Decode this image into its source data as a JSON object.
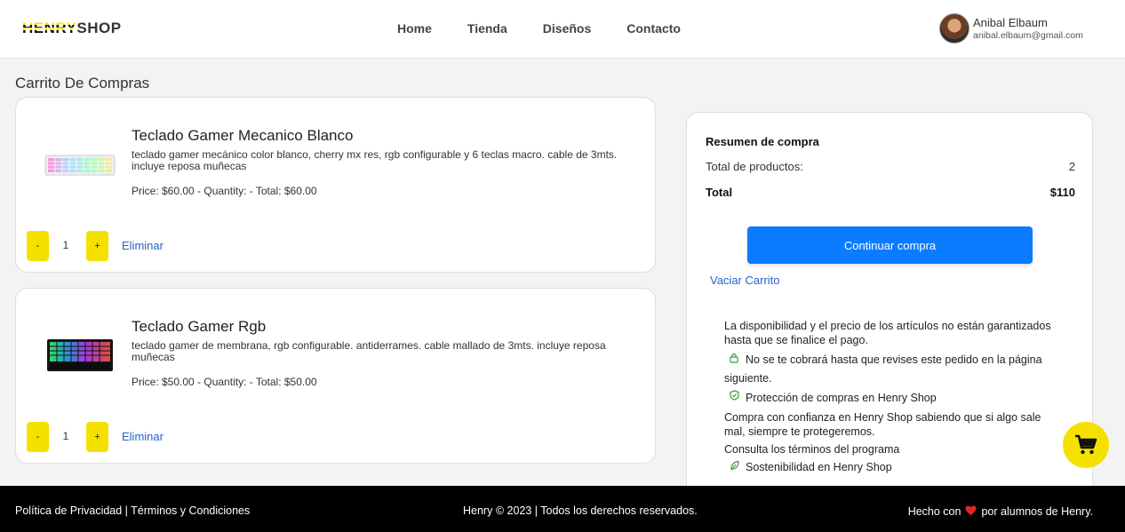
{
  "header": {
    "logo_henry": "HENRY",
    "logo_shop": "SHOP",
    "nav": [
      "Home",
      "Tienda",
      "Diseños",
      "Contacto"
    ],
    "user": {
      "name": "Anibal Elbaum",
      "email": "anibal.elbaum@gmail.com"
    }
  },
  "page_title": "Carrito De Compras",
  "cart": {
    "items": [
      {
        "title": "Teclado Gamer Mecanico Blanco",
        "description": "teclado gamer mecánico color blanco, cherry mx res, rgb configurable y 6 teclas macro. cable de 3mts. incluye reposa muñecas",
        "price_line": "Price: $60.00 - Quantity: - Total: $60.00",
        "quantity": "1",
        "minus_label": "-",
        "plus_label": "+",
        "remove_label": "Eliminar",
        "image": "white-rgb-keyboard"
      },
      {
        "title": "Teclado Gamer Rgb",
        "description": "teclado gamer de membrana, rgb configurable. antiderrames. cable mallado de 3mts. incluye reposa muñecas",
        "price_line": "Price: $50.00 - Quantity: - Total: $50.00",
        "quantity": "1",
        "minus_label": "-",
        "plus_label": "+",
        "remove_label": "Eliminar",
        "image": "black-rgb-keyboard"
      }
    ]
  },
  "summary": {
    "title": "Resumen de compra",
    "products_label": "Total de productos:",
    "products_count": "2",
    "total_label": "Total",
    "total_value": "$110",
    "continue_label": "Continuar compra",
    "empty_label": "Vaciar Carrito",
    "info_1": "La disponibilidad y el precio de los artículos no están garantizados hasta que se finalice el pago.",
    "info_2": "No se te cobrará hasta que revises este pedido en la página siguiente.",
    "info_3": "Protección de compras en Henry Shop",
    "info_4": "Compra con confianza en Henry Shop sabiendo que si algo sale mal, siempre te protegeremos.",
    "info_5": "Consulta los términos del programa",
    "info_6": "Sostenibilidad en Henry Shop"
  },
  "footer": {
    "privacy": "Política de Privacidad",
    "separator": " | ",
    "terms": "Términos y Condiciones",
    "copyright": "Henry © 2023 | Todos los derechos reservados.",
    "made_prefix": "Hecho con",
    "made_suffix": "por alumnos de Henry."
  },
  "icons": {
    "lock": "lock-icon",
    "shield": "shield-icon",
    "leaf": "leaf-icon",
    "cart": "cart-icon",
    "heart": "heart-icon"
  },
  "colors": {
    "accent_yellow": "#f5e100",
    "primary_blue": "#0b7bff",
    "link_blue": "#2563c9",
    "footer_bg": "#000000",
    "heart_red": "#e0242b"
  }
}
